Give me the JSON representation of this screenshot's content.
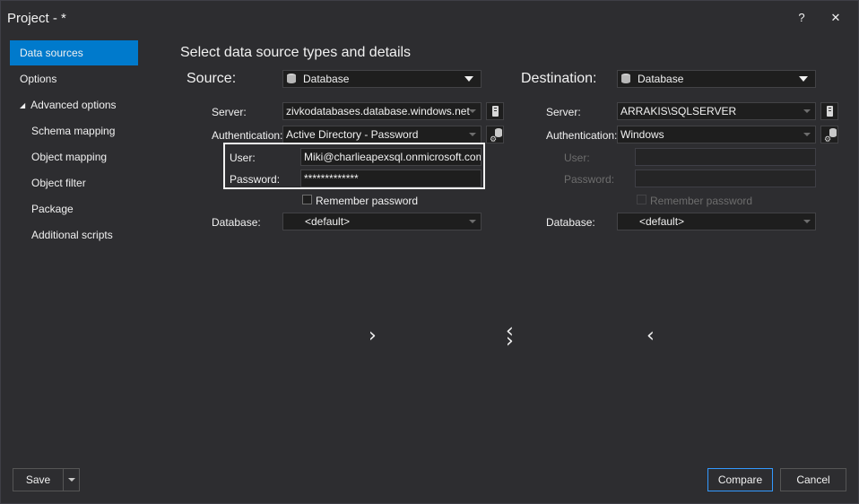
{
  "window": {
    "title": "Project - *",
    "help_icon": "?",
    "close_icon": "✕"
  },
  "sidebar": {
    "items": [
      {
        "label": "Data sources",
        "active": true
      },
      {
        "label": "Options"
      },
      {
        "label": "Advanced options",
        "expanded": true
      },
      {
        "label": "Schema mapping"
      },
      {
        "label": "Object mapping"
      },
      {
        "label": "Object filter"
      },
      {
        "label": "Package"
      },
      {
        "label": "Additional scripts"
      }
    ]
  },
  "main": {
    "heading": "Select data source types and details",
    "source": {
      "section_label": "Source:",
      "type": "Database",
      "server_label": "Server:",
      "server_value": "zivkodatabases.database.windows.net",
      "auth_label": "Authentication:",
      "auth_value": "Active Directory - Password",
      "user_label": "User:",
      "user_value": "Miki@charlieapexsql.onmicrosoft.com",
      "password_label": "Password:",
      "password_value": "*************",
      "remember_label": "Remember password",
      "database_label": "Database:",
      "database_value": "<default>"
    },
    "destination": {
      "section_label": "Destination:",
      "type": "Database",
      "server_label": "Server:",
      "server_value": "ARRAKIS\\SQLSERVER",
      "auth_label": "Authentication:",
      "auth_value": "Windows",
      "user_label": "User:",
      "user_value": "",
      "password_label": "Password:",
      "password_value": "",
      "remember_label": "Remember password",
      "database_label": "Database:",
      "database_value": "<default>"
    },
    "arrows": {
      "copy_right": "›",
      "swap_top": "‹",
      "swap_bottom": "›",
      "copy_left": "‹"
    }
  },
  "footer": {
    "save_label": "Save",
    "compare_label": "Compare",
    "cancel_label": "Cancel"
  },
  "colors": {
    "accent": "#007acc",
    "background": "#2d2d30",
    "field": "#1e1e1e"
  }
}
